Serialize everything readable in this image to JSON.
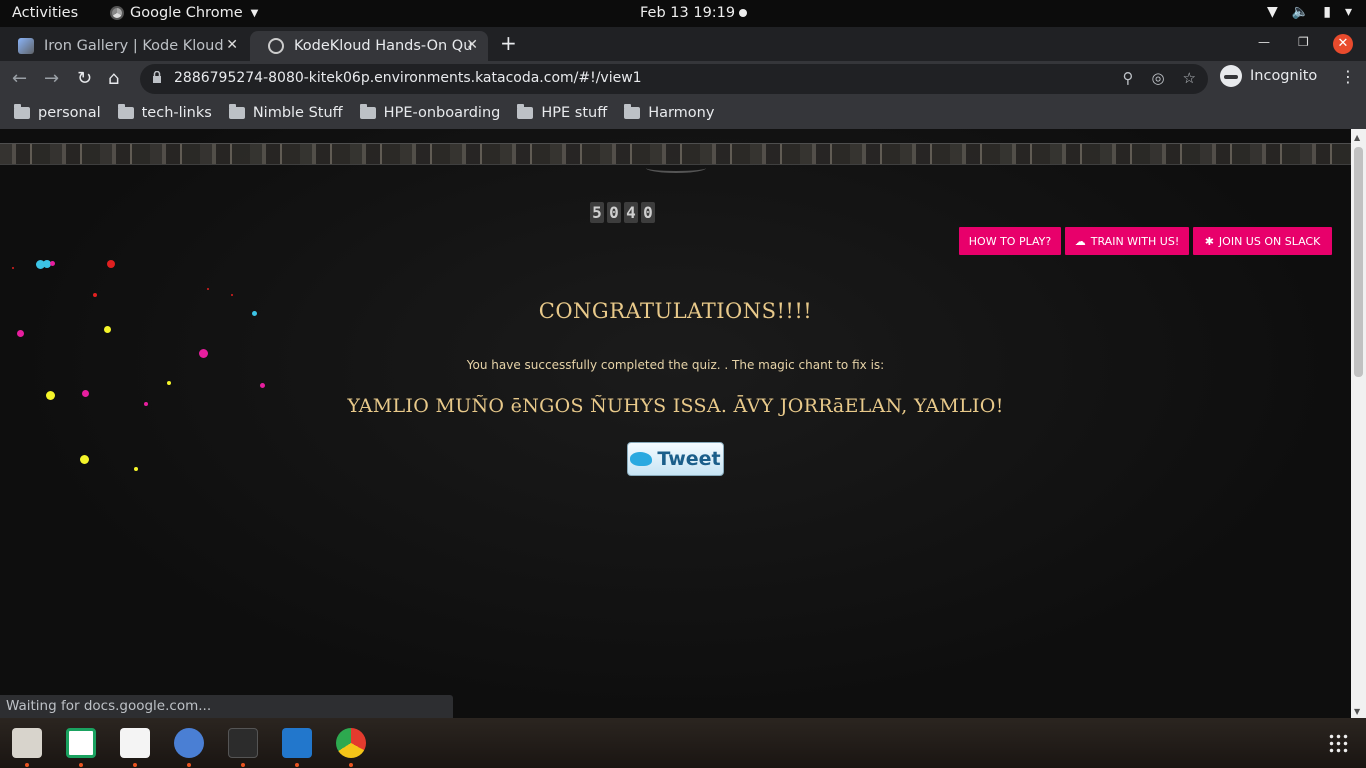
{
  "system_bar": {
    "activities": "Activities",
    "app_name": "Google Chrome",
    "clock": "Feb 13  19:19"
  },
  "tabs": [
    {
      "title": "Iron Gallery | Kode Kloud",
      "active": false
    },
    {
      "title": "KodeKloud Hands-On Qui",
      "active": true
    }
  ],
  "toolbar": {
    "url": "2886795274-8080-kitek06p.environments.katacoda.com/#!/view1",
    "profile": "Incognito"
  },
  "bookmarks": [
    "personal",
    "tech-links",
    "Nimble Stuff",
    "HPE-onboarding",
    "HPE stuff",
    "Harmony"
  ],
  "page": {
    "counter": [
      "5",
      "0",
      "4",
      "0"
    ],
    "buttons": {
      "how_to_play": "HOW TO PLAY?",
      "train": "TRAIN WITH US!",
      "slack": "JOIN US ON SLACK"
    },
    "heading": "CONGRATULATIONS!!!!",
    "message": "You have successfully completed the quiz. . The magic chant to fix is:",
    "chant": "YAMLIO MUÑO ēNGOS ÑUHYS ISSA. ĀVY JORRāELAN, YAMLIO!",
    "tweet_label": "Tweet"
  },
  "status_text": "Waiting for docs.google.com...",
  "colors": {
    "accent_pink": "#e8006b",
    "heading_gold": "#e8c98a",
    "page_bg": "#141414"
  }
}
